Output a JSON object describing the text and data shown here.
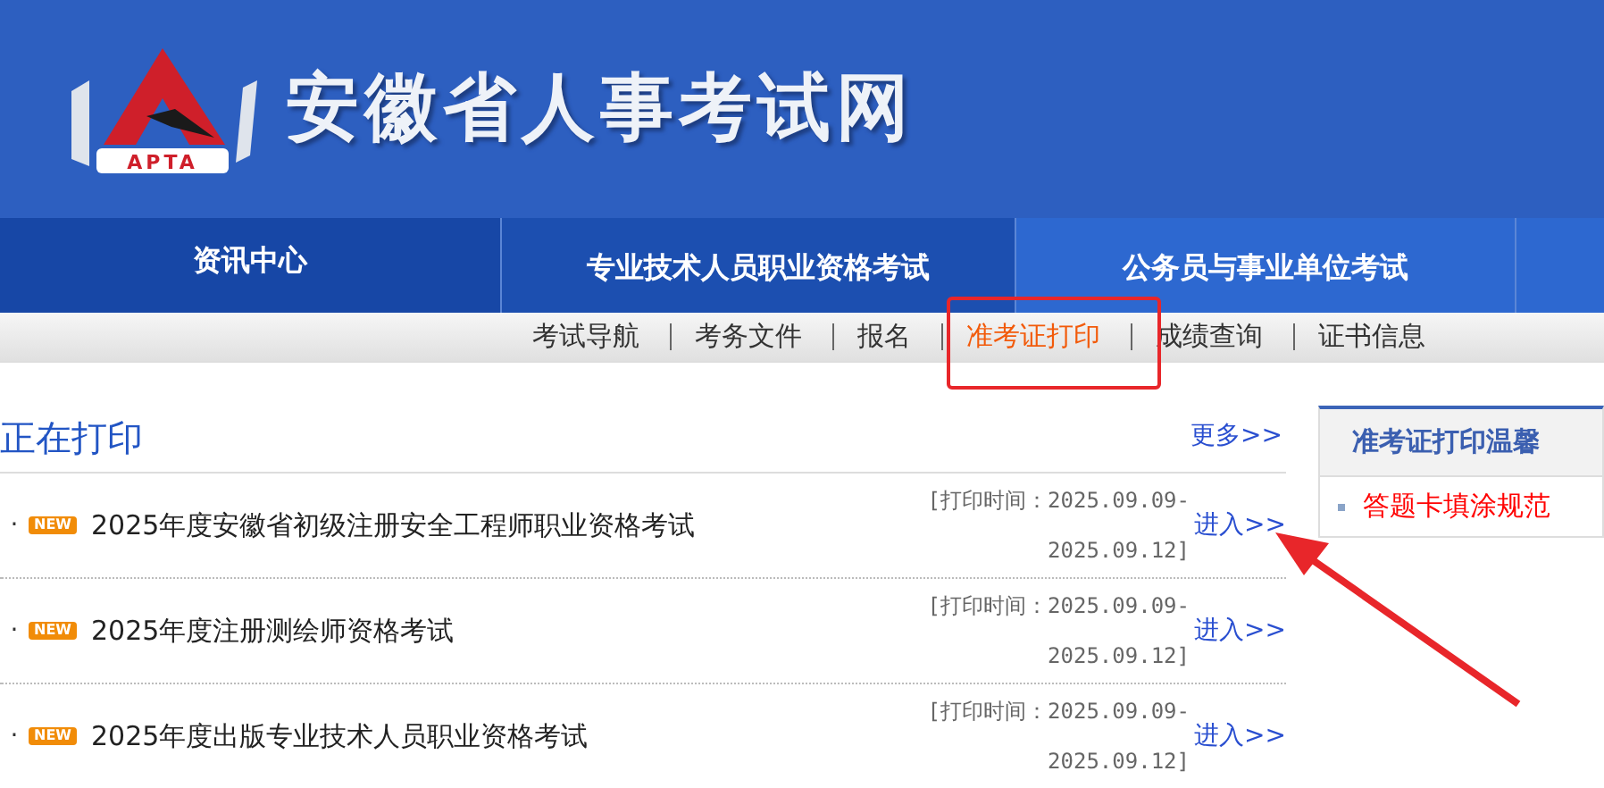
{
  "header": {
    "logo_text": "APTA",
    "site_title": "安徽省人事考试网"
  },
  "main_tabs": [
    {
      "label": "资讯中心",
      "selected": true
    },
    {
      "label": "专业技术人员职业资格考试",
      "selected": false
    },
    {
      "label": "公务员与事业单位考试",
      "selected": false
    }
  ],
  "sub_nav": [
    {
      "label": "考试导航",
      "selected": false
    },
    {
      "label": "考务文件",
      "selected": false
    },
    {
      "label": "报名",
      "selected": false
    },
    {
      "label": "准考证打印",
      "selected": true
    },
    {
      "label": "成绩查询",
      "selected": false
    },
    {
      "label": "证书信息",
      "selected": false
    }
  ],
  "section": {
    "title": "正在打印",
    "more": "更多>>",
    "items": [
      {
        "bullet": "·",
        "badge": "NEW",
        "title": "2025年度安徽省初级注册安全工程师职业资格考试",
        "time_start": "[打印时间：2025.09.09-",
        "time_end": "2025.09.12]",
        "link": "进入>>"
      },
      {
        "bullet": "·",
        "badge": "NEW",
        "title": "2025年度注册测绘师资格考试",
        "time_start": "[打印时间：2025.09.09-",
        "time_end": "2025.09.12]",
        "link": "进入>>"
      },
      {
        "bullet": "·",
        "badge": "NEW",
        "title": "2025年度出版专业技术人员职业资格考试",
        "time_start": "[打印时间：2025.09.09-",
        "time_end": "2025.09.12]",
        "link": "进入>>"
      }
    ]
  },
  "sidebar": {
    "title": "准考证打印温馨",
    "items": [
      {
        "label": "答题卡填涂规范"
      }
    ]
  }
}
